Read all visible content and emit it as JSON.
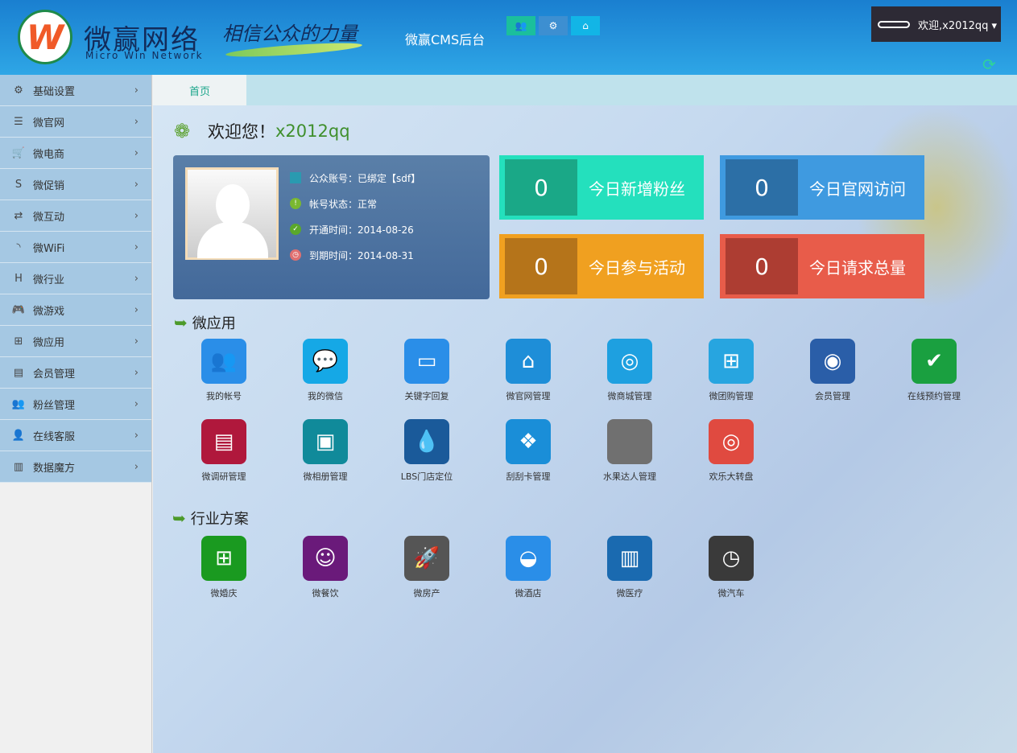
{
  "header": {
    "logo_letter": "W",
    "brand": "微赢网络",
    "brand_en": "Micro Win Network",
    "slogan": "相信公众的力量",
    "cms_title": "微赢CMS后台",
    "user_label": "欢迎,x2012qq ▾",
    "refresh": "⟳"
  },
  "toolbar": [
    {
      "icon": "users-icon",
      "glyph": "👥",
      "color": "#1bbf9c"
    },
    {
      "icon": "gear-icon",
      "glyph": "⚙",
      "color": "#3d8fd1"
    },
    {
      "icon": "home-icon",
      "glyph": "⌂",
      "color": "#12b5e6"
    }
  ],
  "sidebar": [
    {
      "label": "基础设置",
      "glyph": "⚙"
    },
    {
      "label": "微官网",
      "glyph": "☰"
    },
    {
      "label": "微电商",
      "glyph": "🛒"
    },
    {
      "label": "微促销",
      "glyph": "S"
    },
    {
      "label": "微互动",
      "glyph": "⇄"
    },
    {
      "label": "微WiFi",
      "glyph": "◝"
    },
    {
      "label": "微行业",
      "glyph": "H"
    },
    {
      "label": "微游戏",
      "glyph": "🎮"
    },
    {
      "label": "微应用",
      "glyph": "⊞"
    },
    {
      "label": "会员管理",
      "glyph": "▤"
    },
    {
      "label": "粉丝管理",
      "glyph": "👥"
    },
    {
      "label": "在线客服",
      "glyph": "👤"
    },
    {
      "label": "数据魔方",
      "glyph": "▥"
    }
  ],
  "tabs": [
    {
      "label": "首页"
    }
  ],
  "welcome": {
    "text": "欢迎您！",
    "username": "x2012qq"
  },
  "profile": {
    "lines": [
      "公众账号：已绑定【sdf】",
      "帐号状态：正常",
      "开通时间：2014-08-26",
      "到期时间：2014-08-31"
    ]
  },
  "stats": [
    {
      "value": "0",
      "label": "今日新增粉丝",
      "bg": "#24e0bd",
      "dark": "#1aa887"
    },
    {
      "value": "0",
      "label": "今日官网访问",
      "bg": "#3f9ae0",
      "dark": "#2c6fa6"
    },
    {
      "value": "0",
      "label": "今日参与活动",
      "bg": "#f0a020",
      "dark": "#b5741a"
    },
    {
      "value": "0",
      "label": "今日请求总量",
      "bg": "#e85c4a",
      "dark": "#ad3d32"
    }
  ],
  "sections": {
    "apps": "微应用",
    "industry": "行业方案"
  },
  "apps": [
    {
      "label": "我的帐号",
      "color": "#2a8ee8",
      "glyph": "👥"
    },
    {
      "label": "我的微信",
      "color": "#15a8e6",
      "glyph": "💬"
    },
    {
      "label": "关键字回复",
      "color": "#2a8ee8",
      "glyph": "▭"
    },
    {
      "label": "微官网管理",
      "color": "#1e8ed8",
      "glyph": "⌂"
    },
    {
      "label": "微商城管理",
      "color": "#1ea0e0",
      "glyph": "◎"
    },
    {
      "label": "微团购管理",
      "color": "#27a5e0",
      "glyph": "⊞"
    },
    {
      "label": "会员管理",
      "color": "#2a5ea8",
      "glyph": "◉"
    },
    {
      "label": "在线预约管理",
      "color": "#1aa040",
      "glyph": "✔"
    },
    {
      "label": "微调研管理",
      "color": "#b0183c",
      "glyph": "▤"
    },
    {
      "label": "微相册管理",
      "color": "#108a9a",
      "glyph": "▣"
    },
    {
      "label": "LBS门店定位",
      "color": "#1a5a9a",
      "glyph": "💧"
    },
    {
      "label": "刮刮卡管理",
      "color": "#1a8ed8",
      "glyph": "❖"
    },
    {
      "label": "水果达人管理",
      "color": "#707070",
      "glyph": ""
    },
    {
      "label": "欢乐大转盘",
      "color": "#e04a40",
      "glyph": "◎"
    }
  ],
  "industry": [
    {
      "label": "微婚庆",
      "color": "#1a9a20",
      "glyph": "⊞"
    },
    {
      "label": "微餐饮",
      "color": "#6a1a7a",
      "glyph": "☺"
    },
    {
      "label": "微房产",
      "color": "#555",
      "glyph": "🚀"
    },
    {
      "label": "微酒店",
      "color": "#2a8ee8",
      "glyph": "◒"
    },
    {
      "label": "微医疗",
      "color": "#1a6ab0",
      "glyph": "▥"
    },
    {
      "label": "微汽车",
      "color": "#3a3a3a",
      "glyph": "◷"
    }
  ]
}
